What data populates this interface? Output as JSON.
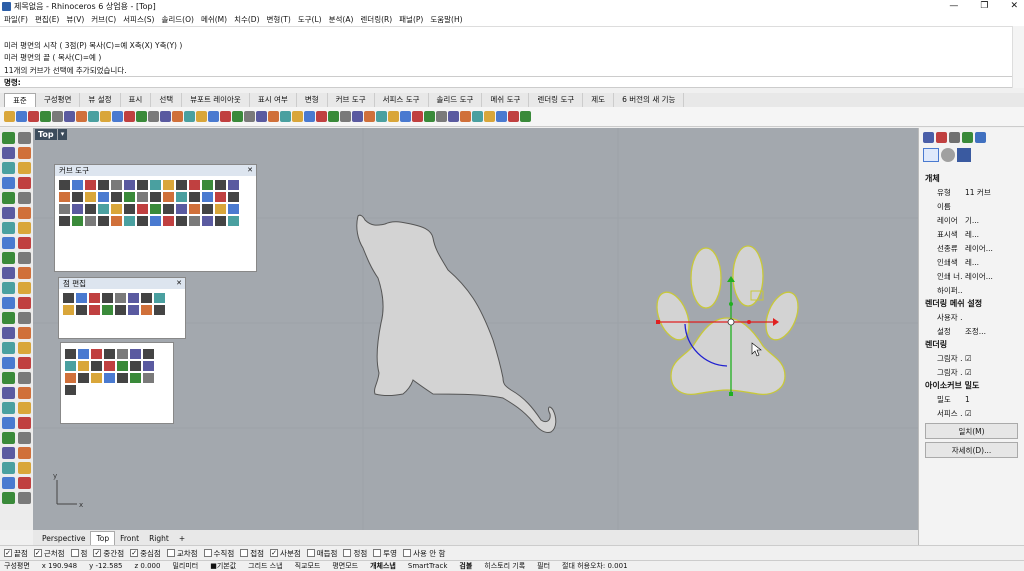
{
  "window": {
    "title": "제목없음 - Rhinoceros 6 상업용 - [Top]",
    "controls": [
      "—",
      "❐",
      "✕"
    ]
  },
  "menu": [
    "파일(F)",
    "편집(E)",
    "뷰(V)",
    "커브(C)",
    "서피스(S)",
    "솔리드(O)",
    "메쉬(M)",
    "치수(D)",
    "변형(T)",
    "도구(L)",
    "분석(A)",
    "렌더링(R)",
    "패널(P)",
    "도움말(H)"
  ],
  "command_history": [
    "미러 평면의 시작 ( 3점(P)  복사(C)=예  X축(X)  Y축(Y) )",
    "미러 평면의 끝 ( 복사(C)=예 )",
    "11개의 커브가 선택에 추가되었습니다."
  ],
  "command_prompt": "명령:",
  "toolbar_tabs": [
    "표준",
    "구성평면",
    "뷰 설정",
    "표시",
    "선택",
    "뷰포트 레이아웃",
    "표시 여부",
    "변형",
    "커브 도구",
    "서피스 도구",
    "솔리드 도구",
    "메쉬 도구",
    "렌더링 도구",
    "제도",
    "6 버전의 새 기능"
  ],
  "active_tab": "표준",
  "viewport": {
    "label": "Top",
    "arrow": "▾"
  },
  "palettes": {
    "curve_tools": {
      "title": "커브 도구",
      "close": "✕"
    },
    "point_edit": {
      "title": "점 편집",
      "close": "✕"
    }
  },
  "viewport_tabs": [
    "Perspective",
    "Top",
    "Front",
    "Right"
  ],
  "add_tab": "+",
  "osnaps": [
    {
      "label": "끝점",
      "checked": true
    },
    {
      "label": "근처점",
      "checked": true
    },
    {
      "label": "점",
      "checked": false
    },
    {
      "label": "중간점",
      "checked": true
    },
    {
      "label": "중심점",
      "checked": true
    },
    {
      "label": "교차점",
      "checked": false
    },
    {
      "label": "수직점",
      "checked": false
    },
    {
      "label": "접점",
      "checked": false
    },
    {
      "label": "사분점",
      "checked": true
    },
    {
      "label": "매듭점",
      "checked": false
    },
    {
      "label": "정점",
      "checked": false
    },
    {
      "label": "투영",
      "checked": false
    },
    {
      "label": "사용 안 함",
      "checked": false
    }
  ],
  "status_bar": [
    "구성평면",
    "x 190.948",
    "y -12.585",
    "z 0.000",
    "밀리미터",
    "■기본값",
    "그리드 스냅",
    "직교모드",
    "평면모드",
    "개체스냅",
    "SmartTrack",
    "검볼",
    "히스토리 기록",
    "필터",
    "절대 허용오차: 0.001"
  ],
  "properties": {
    "section_object": "개체",
    "rows": [
      {
        "key": "유형",
        "value": "11 커브"
      },
      {
        "key": "이름",
        "value": ""
      },
      {
        "key": "레이어",
        "value": "기..."
      },
      {
        "key": "표시색",
        "value": "레..."
      },
      {
        "key": "선종류",
        "value": "레이어..."
      },
      {
        "key": "인쇄색",
        "value": "레..."
      },
      {
        "key": "인쇄 너...",
        "value": "레이어..."
      },
      {
        "key": "하이퍼...",
        "value": ""
      }
    ],
    "section_render_mesh": "렌더링 메쉬 설정",
    "render_mesh_rows": [
      {
        "key": "사용자 ...",
        "value": ""
      },
      {
        "key": "설정",
        "value": "조정..."
      }
    ],
    "section_rendering": "렌더링",
    "rendering_rows": [
      {
        "key": "그림자 ...",
        "value": "☑"
      },
      {
        "key": "그림자 ...",
        "value": "☑"
      }
    ],
    "section_isocurve": "아이소커브 밀도",
    "isocurve_rows": [
      {
        "key": "밀도",
        "value": "1"
      },
      {
        "key": "서피스 ...",
        "value": "☑"
      }
    ],
    "button_match": "일치(M)",
    "button_details": "자세히(D)..."
  },
  "colors": {
    "viewport_bg": "#a3a8ae",
    "shape_fill": "#d3d3d3",
    "paw_outline": "#d8d84a",
    "gumball_x": "#e02020",
    "gumball_y": "#20b020",
    "gumball_rot": "#2020d0"
  }
}
